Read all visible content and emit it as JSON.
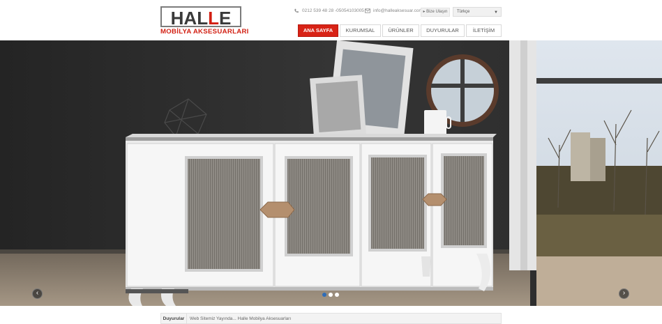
{
  "header": {
    "logo": {
      "word_left": "HAL",
      "word_accent": "L",
      "word_right": "E",
      "tagline": "MOBİLYA AKSESUARLARI"
    },
    "phone": "0212 539 48 28 -05054103005",
    "email": "info@halleaksesuar.com",
    "contact_button": "▸ Bize Ulaşın",
    "language": "Türkçe",
    "nav": [
      {
        "label": "ANA SAYFA",
        "active": true
      },
      {
        "label": "KURUMSAL",
        "active": false
      },
      {
        "label": "ÜRÜNLER",
        "active": false
      },
      {
        "label": "DUYURULAR",
        "active": false
      },
      {
        "label": "İLETİŞİM",
        "active": false
      }
    ]
  },
  "slider": {
    "slide_count": 3,
    "current_slide": 1,
    "prev_icon": "chevron-left-icon",
    "next_icon": "chevron-right-icon"
  },
  "news": {
    "label": "Duyurular",
    "text": "Web Sitemiz Yayında... Halle Mobilya Aksesuarları"
  },
  "colors": {
    "accent": "#d82316",
    "active_dot": "#2f6db8"
  }
}
